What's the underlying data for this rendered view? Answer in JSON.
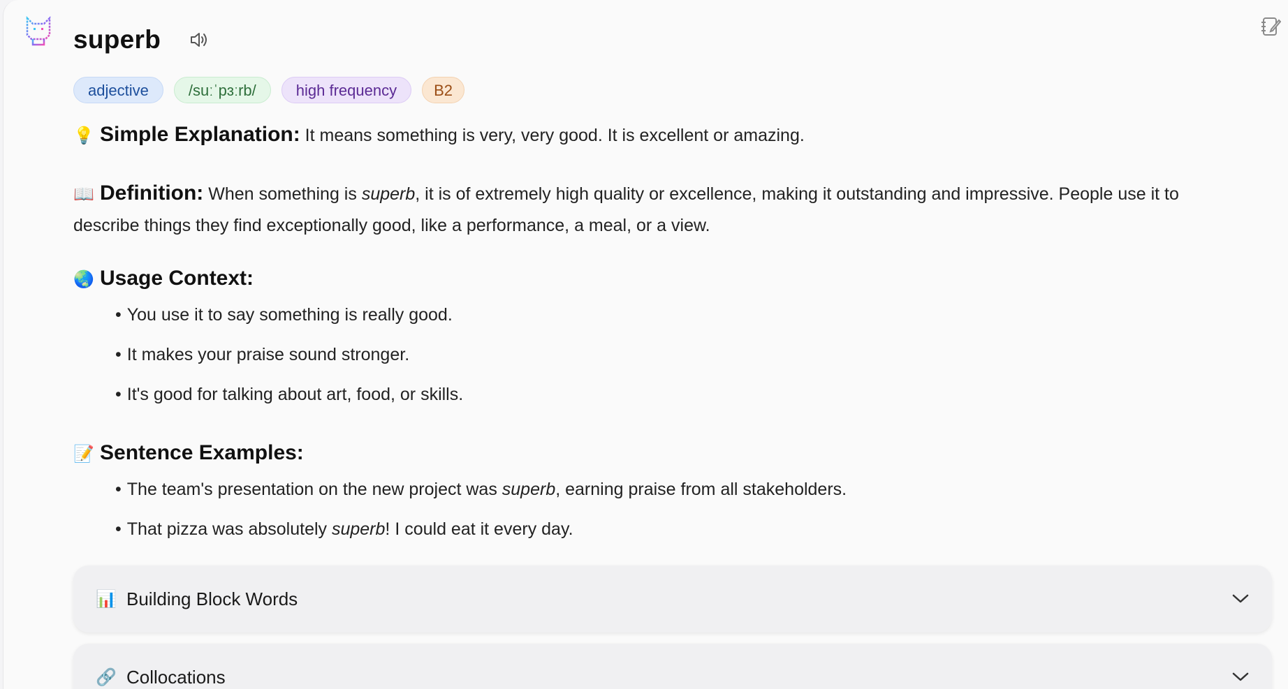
{
  "word": "superb",
  "tags": {
    "pos": "adjective",
    "ipa": "/suːˈpɜːrb/",
    "frequency": "high frequency",
    "level": "B2"
  },
  "simple": {
    "heading": "Simple Explanation:",
    "text": " It means something is very, very good. It is excellent or amazing."
  },
  "definition": {
    "heading": "Definition:",
    "before": " When something is ",
    "word": "superb",
    "after": ", it is of extremely high quality or excellence, making it outstanding and impressive. People use it to describe things they find exceptionally good, like a performance, a meal, or a view."
  },
  "usage": {
    "heading": "Usage Context:",
    "items": [
      "You use it to say something is really good.",
      "It makes your praise sound stronger.",
      "It's good for talking about art, food, or skills."
    ]
  },
  "examples": {
    "heading": "Sentence Examples:",
    "items": [
      {
        "before": "The team's presentation on the new project was ",
        "word": "superb",
        "after": ", earning praise from all stakeholders."
      },
      {
        "before": "That pizza was absolutely ",
        "word": "superb",
        "after": "! I could eat it every day."
      }
    ]
  },
  "accordions": [
    {
      "title": "Building Block Words",
      "icon": "bar-chart-icon"
    },
    {
      "title": "Collocations",
      "icon": "link-icon"
    }
  ],
  "icons": {
    "simple": "lightbulb-icon",
    "definition": "book-icon",
    "usage": "globe-icon",
    "examples": "memo-icon"
  }
}
